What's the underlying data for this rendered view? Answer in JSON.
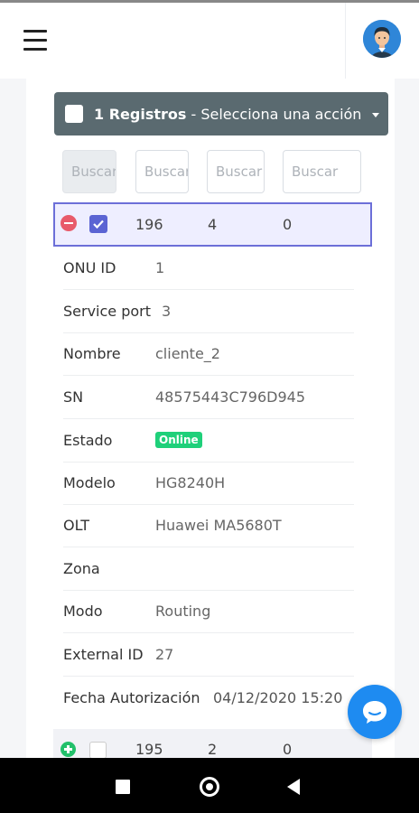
{
  "bulk_actions": {
    "count_label": "1 Registros",
    "action_label": "- Selecciona una acción"
  },
  "search": {
    "placeholders": [
      "Buscar",
      "Buscar",
      "Buscar",
      "Buscar"
    ]
  },
  "selected_row": {
    "col1": "196",
    "col2": "4",
    "col3": "0"
  },
  "details": [
    {
      "label": "ONU ID",
      "value": "1"
    },
    {
      "label": "Service port",
      "value": "3"
    },
    {
      "label": "Nombre",
      "value": "cliente_2"
    },
    {
      "label": "SN",
      "value": "48575443C796D945"
    },
    {
      "label": "Estado",
      "value": "Online"
    },
    {
      "label": "Modelo",
      "value": "HG8240H"
    },
    {
      "label": "OLT",
      "value": "Huawei MA5680T"
    },
    {
      "label": "Zona",
      "value": ""
    },
    {
      "label": "Modo",
      "value": "Routing"
    },
    {
      "label": "External ID",
      "value": "27"
    },
    {
      "label": "Fecha Autorización",
      "value": "04/12/2020 15:20"
    }
  ],
  "next_row": {
    "col1": "195",
    "col2": "2",
    "col3": "0"
  },
  "colors": {
    "status_online": "#1fd07a",
    "bulk_bar": "#5a6a70",
    "selection_border": "#6c6fd8",
    "chat_button": "#1e8bf1"
  },
  "icons": {
    "menu": "hamburger-icon",
    "user": "avatar-icon",
    "chat": "chat-bubble-icon"
  }
}
